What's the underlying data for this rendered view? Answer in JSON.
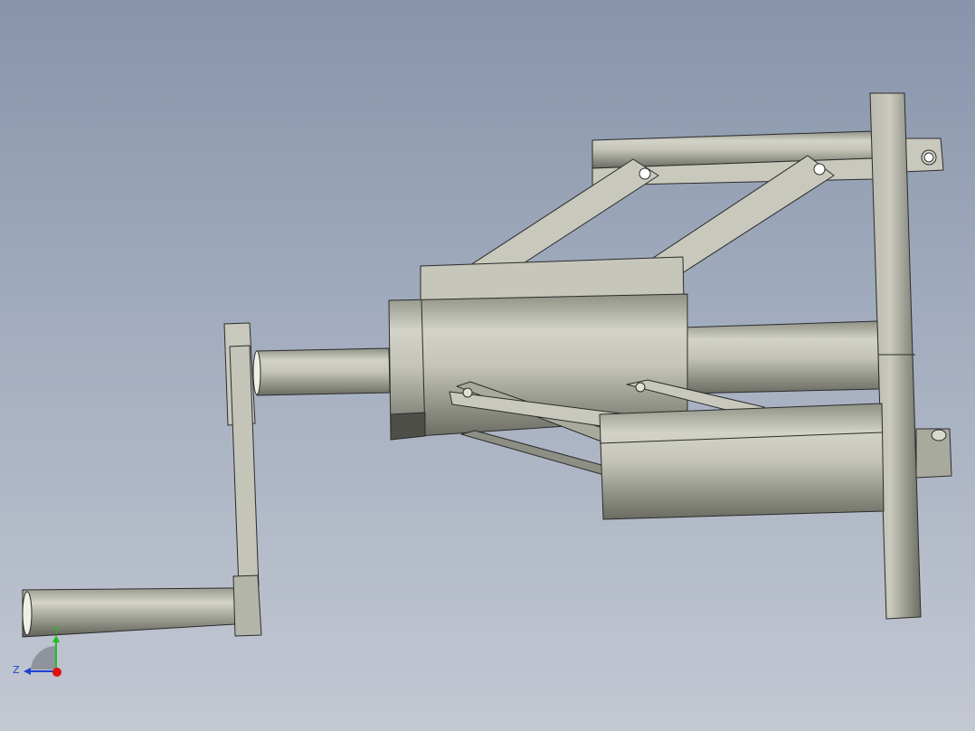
{
  "viewport": {
    "background_top": "#8794aa",
    "background_bottom": "#c3c8d2"
  },
  "model": {
    "face_color": "#c2c2b6",
    "edge_color": "#2b2b2b"
  },
  "triad": {
    "y_label": "Y",
    "z_label": "Z",
    "y_color": "#21c021",
    "z_color": "#1f3fd6",
    "x_color": "#e01010"
  }
}
